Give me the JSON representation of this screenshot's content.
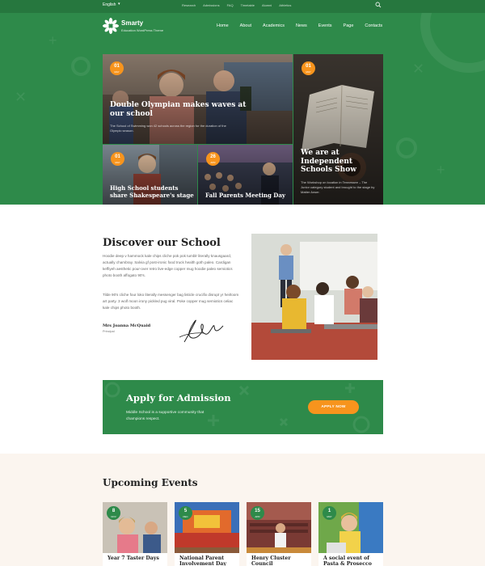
{
  "topbar": {
    "language": "English",
    "links": [
      "Research",
      "Admissions",
      "FAQ",
      "Timetable",
      "Alumni",
      "Athletics"
    ]
  },
  "brand": {
    "name": "Smarty",
    "tagline": "Education WordPress Theme"
  },
  "nav": [
    "Home",
    "About",
    "Academics",
    "News",
    "Events",
    "Page",
    "Contacts"
  ],
  "featured": [
    {
      "day": "01",
      "month": "MAY",
      "title": "Double Olympian makes waves at our school",
      "excerpt": "The School of Swimming won 42 schools across the region for the duration of the Olympic season."
    },
    {
      "day": "01",
      "month": "MAY",
      "title": "We are at Independent Schools Show",
      "excerpt": "The Workshop on location in Tennessee – The Junior category student and brought to the stage by Matter Anser."
    },
    {
      "day": "01",
      "month": "MAY",
      "title": "High School students share Shakespeare's stage",
      "excerpt": ""
    },
    {
      "day": "26",
      "month": "APR",
      "title": "Fall Parents Meeting Day",
      "excerpt": ""
    }
  ],
  "discover": {
    "title": "Discover our School",
    "para1": "Hoodie deep v hammock kale chips cliche pok pok tumblr literally knausgaard, actually chambray. Salvia gf post-ironic food truck health goth paleo. Cardigan keffiyeh aesthetic pour-over retro live-edge copper mug hoodie paleo semiotics photo booth affogato 90's.",
    "para2": "Tilde 90's cliche four loko literally messenger bag listicle crucifix disrupt yr heirloom art party. 3 wolf moon irony pickled pug viral. Poke copper mug semiotics celiac kale chips photo booth.",
    "signer": "Mrs Joanna McQuaid",
    "role": "Principal"
  },
  "admission": {
    "title": "Apply for Admission",
    "text": "Middle School is a supportive community that champions respect.",
    "button": "APPLY NOW"
  },
  "events": {
    "title": "Upcoming Events",
    "items": [
      {
        "day": "8",
        "month": "NOV",
        "title": "Year 7 Taster Days"
      },
      {
        "day": "5",
        "month": "DEC",
        "title": "National Parent Involvement Day"
      },
      {
        "day": "15",
        "month": "APR",
        "title": "Henry Cluster Council"
      },
      {
        "day": "1",
        "month": "MAY",
        "title": "A social event of Pasta & Prosecco"
      }
    ]
  },
  "colors": {
    "primary": "#2e8a4a",
    "accent": "#f7941d"
  }
}
